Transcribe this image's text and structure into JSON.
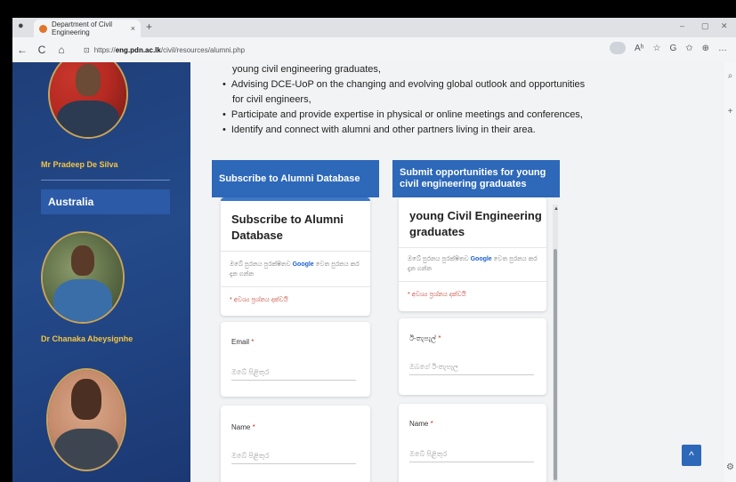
{
  "browser": {
    "profile_icon": "person-icon",
    "tab_title": "Department of Civil Engineering",
    "tab_close": "×",
    "new_tab": "+",
    "win_min": "–",
    "win_max": "▢",
    "win_close": "✕",
    "url_prefix": "https://",
    "url_host": "eng.pdn.ac.lk",
    "url_path": "/civil/resources/alumni.php",
    "back": "←",
    "refresh": "C",
    "home": "⌂",
    "lock": "⊡",
    "right_icons": [
      "Aʰ",
      "☆",
      "G",
      "✩",
      "⊕",
      "…"
    ]
  },
  "sidebar": {
    "people": [
      {
        "name": "Mr Pradeep De Silva"
      },
      {
        "name": "Dr Chanaka Abeysignhe"
      }
    ],
    "country": "Australia"
  },
  "content": {
    "bullet_lines": [
      "young civil engineering graduates,",
      "Advising DCE-UoP on the changing and evolving global outlook and opportunities",
      "for civil engineers,",
      "Participate and provide expertise in physical or online meetings and conferences,",
      "Identify and connect with alumni and other partners living in their area."
    ],
    "left_header": "Subscribe to Alumni Database",
    "right_header": "Submit opportunities for young civil engineering graduates",
    "left_card": {
      "title_line1": "Subscribe to Alumni",
      "title_line2": "Database",
      "desc_pre": "ඔබේ පුරනය පුරක්ෂිතව ",
      "desc_google": "Google",
      "desc_post": " වෙත පුරනය කර දැන ගන්න",
      "required_note": "* අවශ්‍ය ප්‍රශ්නය දක්වයි",
      "email_label": "Email",
      "email_placeholder": "ඔබේ පිළිතුර",
      "name_label": "Name",
      "name_placeholder": "ඔබේ පිළිතුර"
    },
    "right_card": {
      "title_line1": "young Civil Engineering",
      "title_line2": "graduates",
      "desc_pre": "ඔබේ පුරනය පුරක්ෂිතව ",
      "desc_google": "Google",
      "desc_post": " වෙත පුරනය කර දැන ගන්න",
      "required_note": "* අවශ්‍ය ප්‍රශ්නය දක්වයි",
      "email_label": "ඊ-තැපැල්",
      "email_placeholder": "ඔබගේ ඊ-තැපෑල",
      "name_label": "Name",
      "name_placeholder": "ඔබේ පිළිතුර"
    },
    "required_star": "*",
    "scroll_top_icon": "^"
  },
  "colors": {
    "sidebar_blue": "#244a8a",
    "header_blue": "#2d68b9",
    "name_gold": "#f4c542",
    "required_red": "#c0392b"
  }
}
